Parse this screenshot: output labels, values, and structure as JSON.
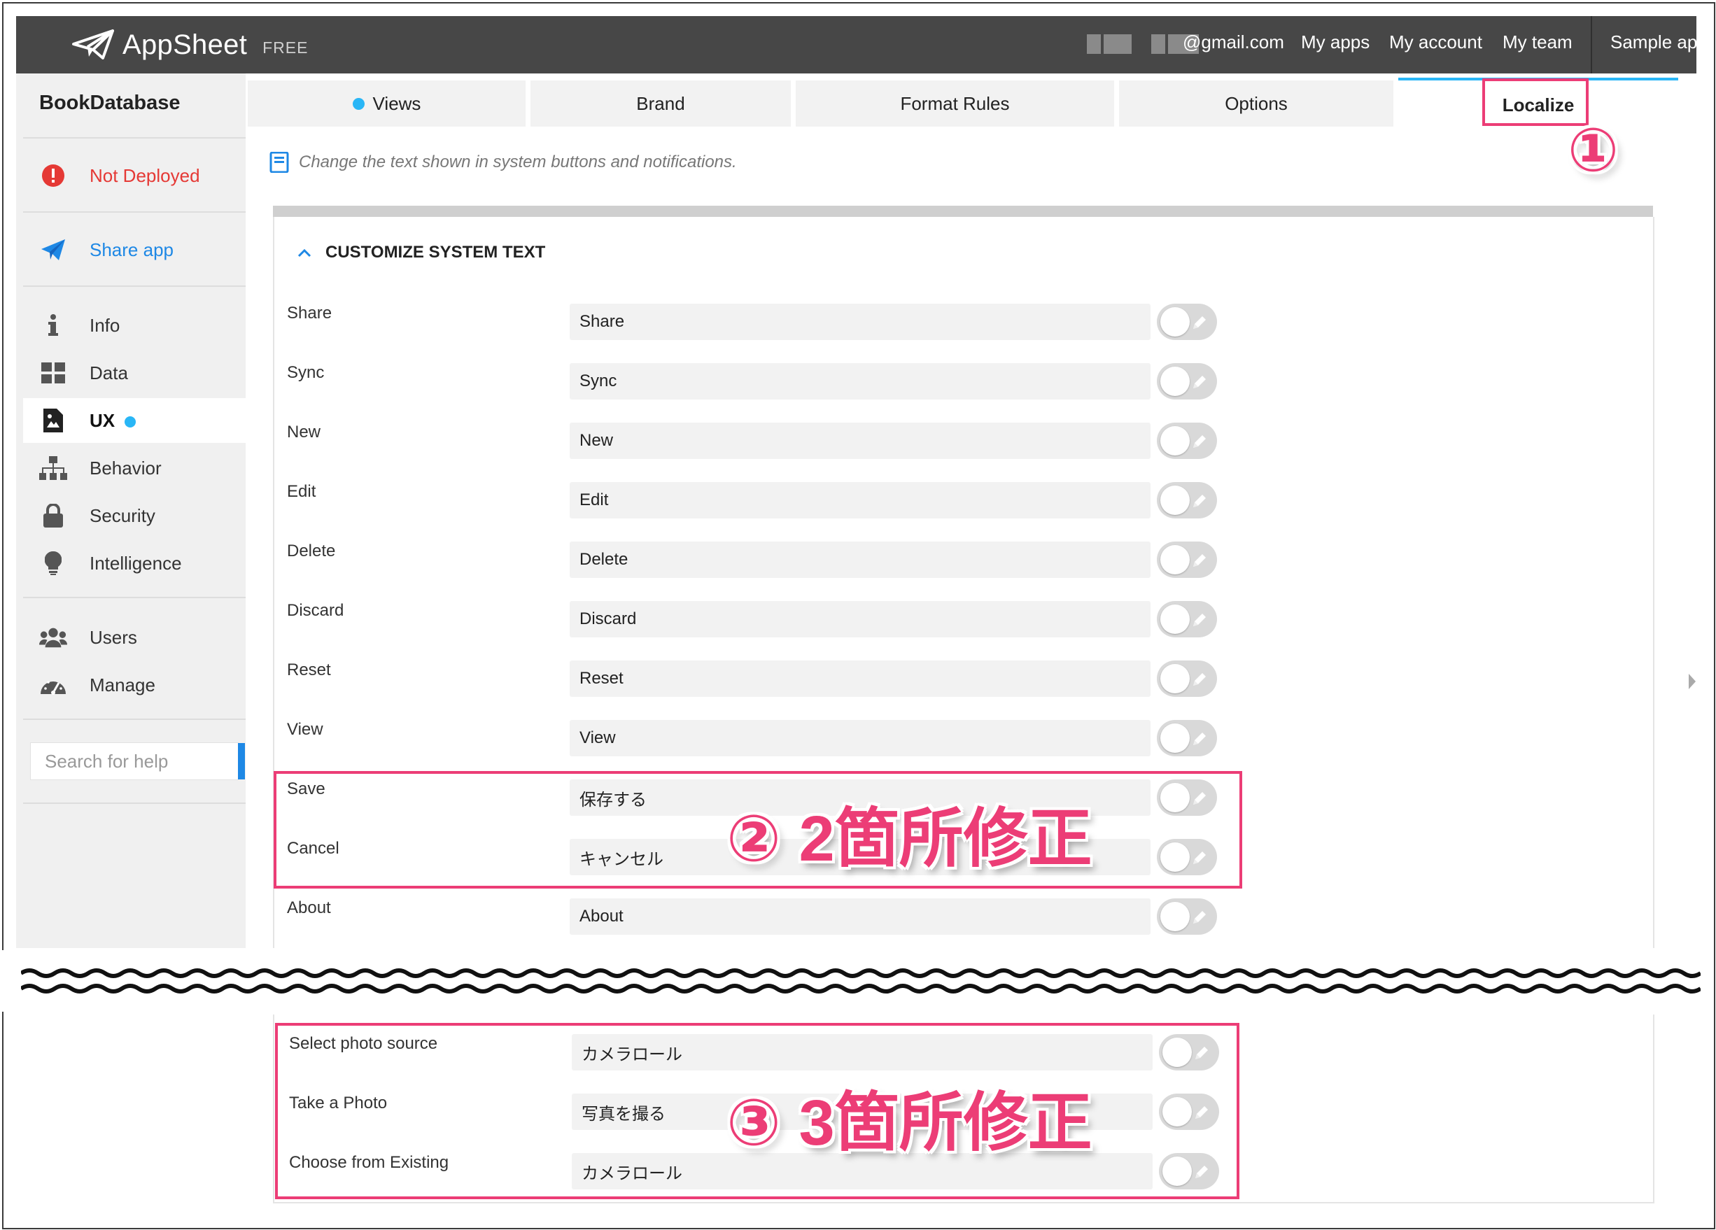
{
  "topbar": {
    "logo_name": "AppSheet",
    "plan": "FREE",
    "email": "@gmail.com",
    "links": [
      "My apps",
      "My account",
      "My team",
      "Sample ap"
    ]
  },
  "sidebar": {
    "app_title": "BookDatabase",
    "status": "Not Deployed",
    "share": "Share app",
    "items": [
      {
        "label": "Info",
        "icon": "info-icon"
      },
      {
        "label": "Data",
        "icon": "data-grid-icon"
      },
      {
        "label": "UX",
        "icon": "ux-icon",
        "active": true
      },
      {
        "label": "Behavior",
        "icon": "behavior-tree-icon"
      },
      {
        "label": "Security",
        "icon": "lock-icon"
      },
      {
        "label": "Intelligence",
        "icon": "lightbulb-icon"
      },
      {
        "label": "Users",
        "icon": "users-icon"
      },
      {
        "label": "Manage",
        "icon": "gauge-icon"
      }
    ],
    "search_placeholder": "Search for help"
  },
  "tabs": [
    "Views",
    "Brand",
    "Format Rules",
    "Options",
    "Localize"
  ],
  "hint": "Change the text shown in system buttons and notifications.",
  "section_title": "CUSTOMIZE SYSTEM TEXT",
  "rows": [
    {
      "label": "Share",
      "value": "Share"
    },
    {
      "label": "Sync",
      "value": "Sync"
    },
    {
      "label": "New",
      "value": "New"
    },
    {
      "label": "Edit",
      "value": "Edit"
    },
    {
      "label": "Delete",
      "value": "Delete"
    },
    {
      "label": "Discard",
      "value": "Discard"
    },
    {
      "label": "Reset",
      "value": "Reset"
    },
    {
      "label": "View",
      "value": "View"
    },
    {
      "label": "Save",
      "value": "保存する"
    },
    {
      "label": "Cancel",
      "value": "キャンセル"
    },
    {
      "label": "About",
      "value": "About"
    }
  ],
  "rows2": [
    {
      "label": "Select photo source",
      "value": "カメラロール"
    },
    {
      "label": "Take a Photo",
      "value": "写真を撮る"
    },
    {
      "label": "Choose from Existing",
      "value": "カメラロール"
    }
  ],
  "annotations": {
    "one": "①",
    "two": "② 2箇所修正",
    "three": "③ 3箇所修正"
  },
  "colors": {
    "accent_blue": "#29b6f6",
    "annotation_pink": "#ec3d76",
    "not_deployed_red": "#e53935",
    "share_blue": "#1e88e5"
  }
}
